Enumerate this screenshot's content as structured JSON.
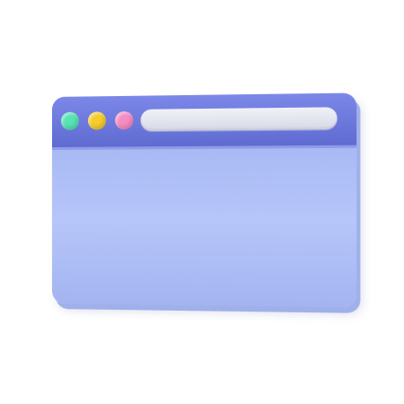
{
  "window": {
    "controls": [
      {
        "name": "green-dot",
        "color": "#57e3b4"
      },
      {
        "name": "yellow-dot",
        "color": "#f4cc2c"
      },
      {
        "name": "pink-dot",
        "color": "#f58cc2"
      }
    ],
    "titlebar_color": "#6a76da",
    "content_color": "#b3c2f8",
    "address_bar_color": "#e3e5ee"
  }
}
